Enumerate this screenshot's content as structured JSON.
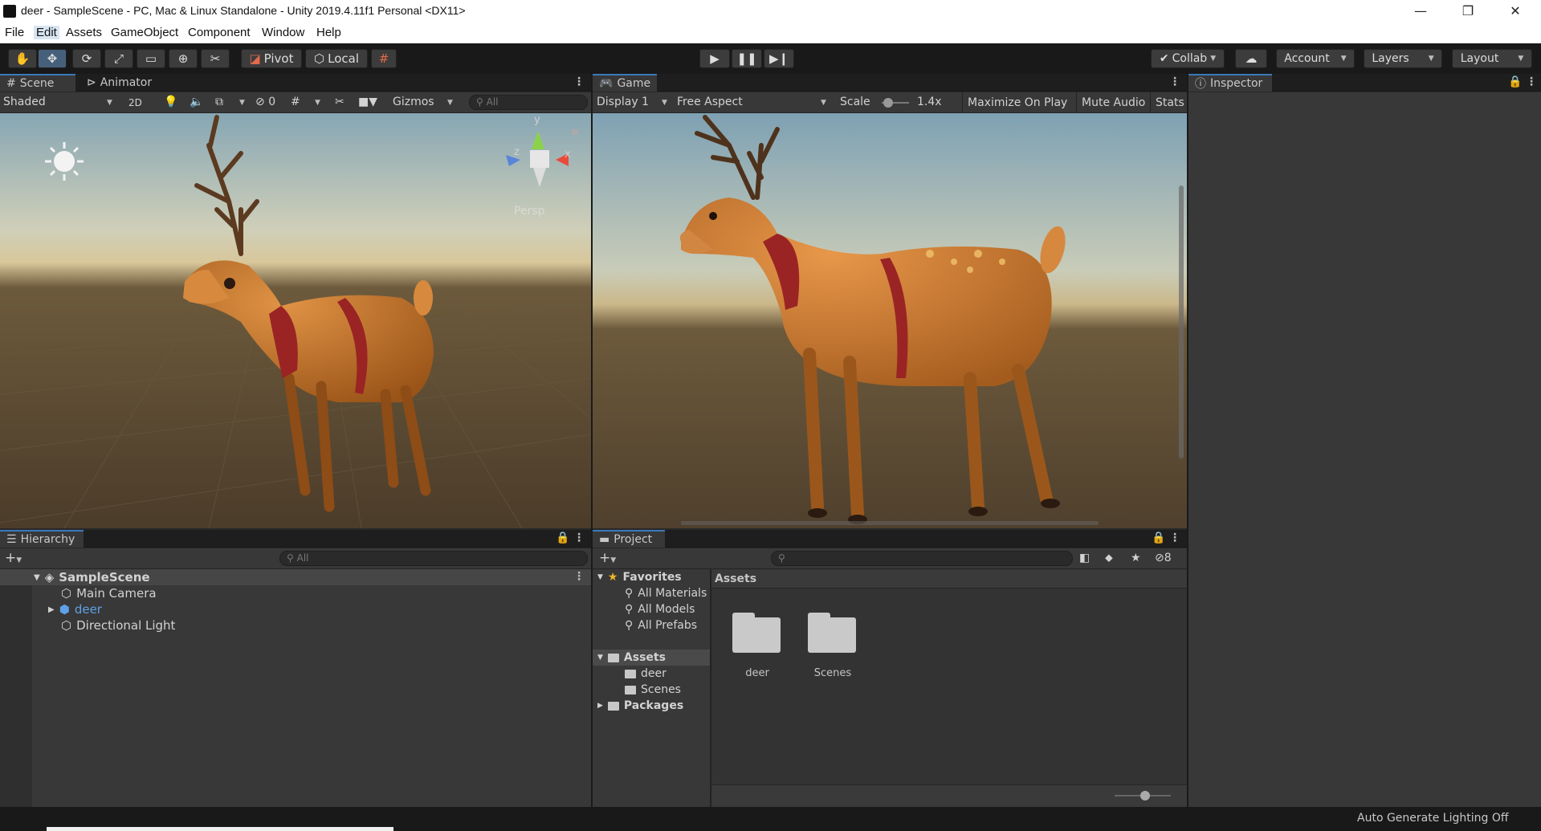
{
  "window": {
    "title": "deer - SampleScene - PC, Mac & Linux Standalone - Unity 2019.4.11f1 Personal <DX11>",
    "minimize": "—",
    "maximize": "❐",
    "close": "✕"
  },
  "menu": [
    "File",
    "Edit",
    "Assets",
    "GameObject",
    "Component",
    "Window",
    "Help"
  ],
  "toolbar": {
    "pivot": "Pivot",
    "local": "Local",
    "collab": "Collab",
    "account": "Account",
    "layers": "Layers",
    "layout": "Layout"
  },
  "scene": {
    "tabs": [
      "Scene",
      "Animator"
    ],
    "shading": "Shaded",
    "mode2d": "2D",
    "hidden_count": "0",
    "gizmos": "Gizmos",
    "search_placeholder": "All",
    "gizmo_y": "y",
    "gizmo_x": "x",
    "gizmo_z": "z",
    "persp": "Persp"
  },
  "game": {
    "tab": "Game",
    "display": "Display 1",
    "aspect": "Free Aspect",
    "scale_label": "Scale",
    "scale_value": "1.4x",
    "maximize": "Maximize On Play",
    "mute": "Mute Audio",
    "stats": "Stats"
  },
  "inspector": {
    "tab": "Inspector"
  },
  "hierarchy": {
    "tab": "Hierarchy",
    "search_placeholder": "All",
    "scene": "SampleScene",
    "items": [
      "Main Camera",
      "deer",
      "Directional Light"
    ]
  },
  "project": {
    "tab": "Project",
    "hidden_count": "8",
    "tree": {
      "favorites": "Favorites",
      "fav_items": [
        "All Materials",
        "All Models",
        "All Prefabs"
      ],
      "assets": "Assets",
      "asset_items": [
        "deer",
        "Scenes"
      ],
      "packages": "Packages"
    },
    "breadcrumb": "Assets",
    "folders": [
      "deer",
      "Scenes"
    ]
  },
  "status": {
    "lighting": "Auto Generate Lighting Off"
  },
  "colors": {
    "accent": "#3a79bb",
    "deer_body": "#c97a2c",
    "collar": "#9a2424"
  }
}
